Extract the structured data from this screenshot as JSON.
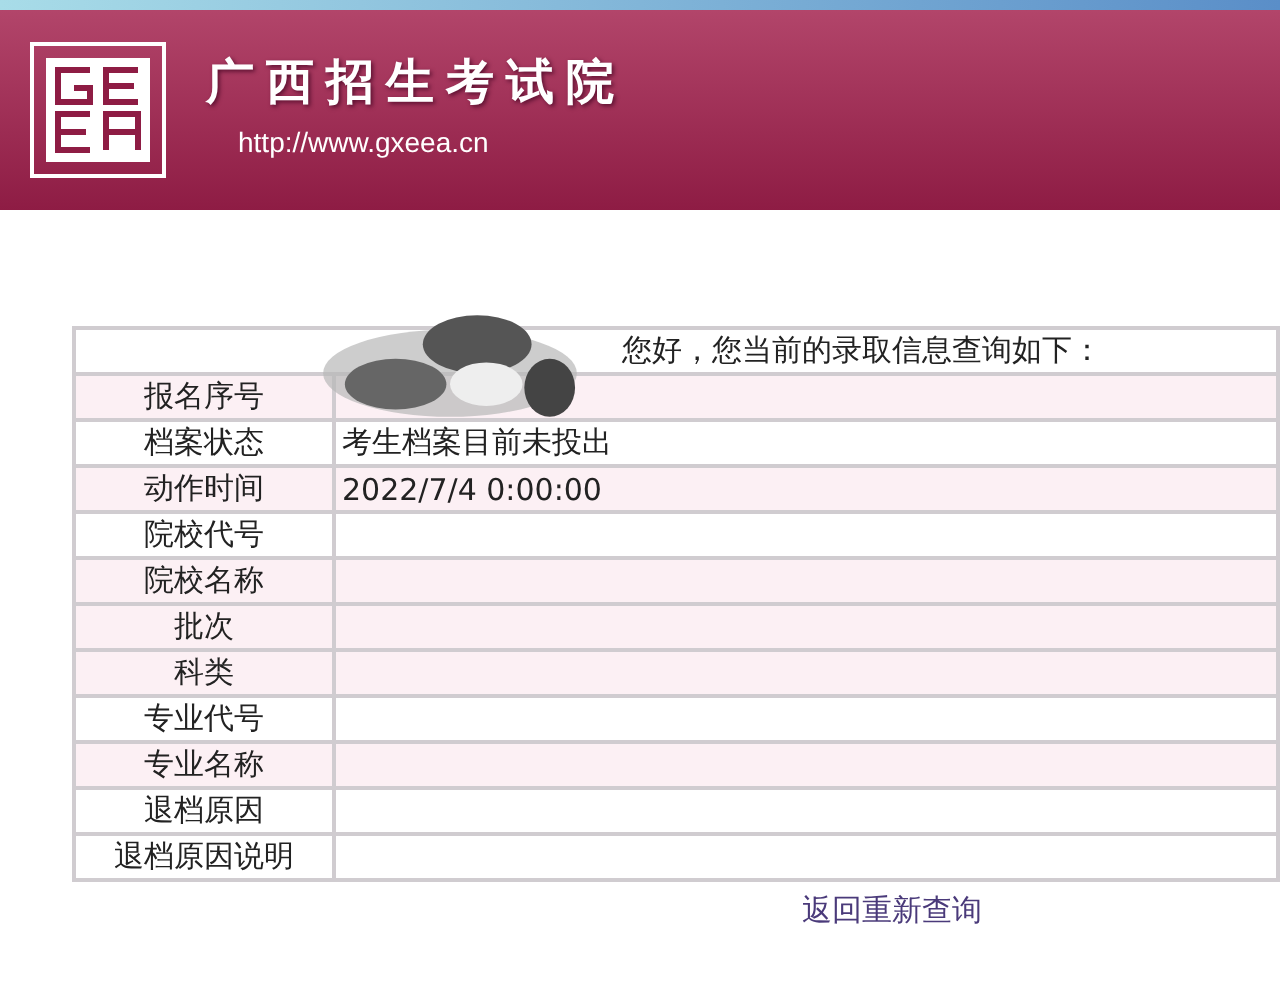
{
  "header": {
    "title": "广西招生考试院",
    "url": "http://www.gxeea.cn"
  },
  "greeting": "您好，您当前的录取信息查询如下：",
  "rows": [
    {
      "label": "报名序号",
      "value": "",
      "shaded": true,
      "redacted": true
    },
    {
      "label": "档案状态",
      "value": "考生档案目前未投出",
      "shaded": false
    },
    {
      "label": "动作时间",
      "value": "2022/7/4 0:00:00",
      "shaded": true
    },
    {
      "label": "院校代号",
      "value": "",
      "shaded": false
    },
    {
      "label": "院校名称",
      "value": "",
      "shaded": true
    },
    {
      "label": "批次",
      "value": "",
      "shaded": true
    },
    {
      "label": "科类",
      "value": "",
      "shaded": true
    },
    {
      "label": "专业代号",
      "value": "",
      "shaded": false
    },
    {
      "label": "专业名称",
      "value": "",
      "shaded": true
    },
    {
      "label": "退档原因",
      "value": "",
      "shaded": false
    },
    {
      "label": "退档原因说明",
      "value": "",
      "shaded": false
    }
  ],
  "back_link": "返回重新查询"
}
